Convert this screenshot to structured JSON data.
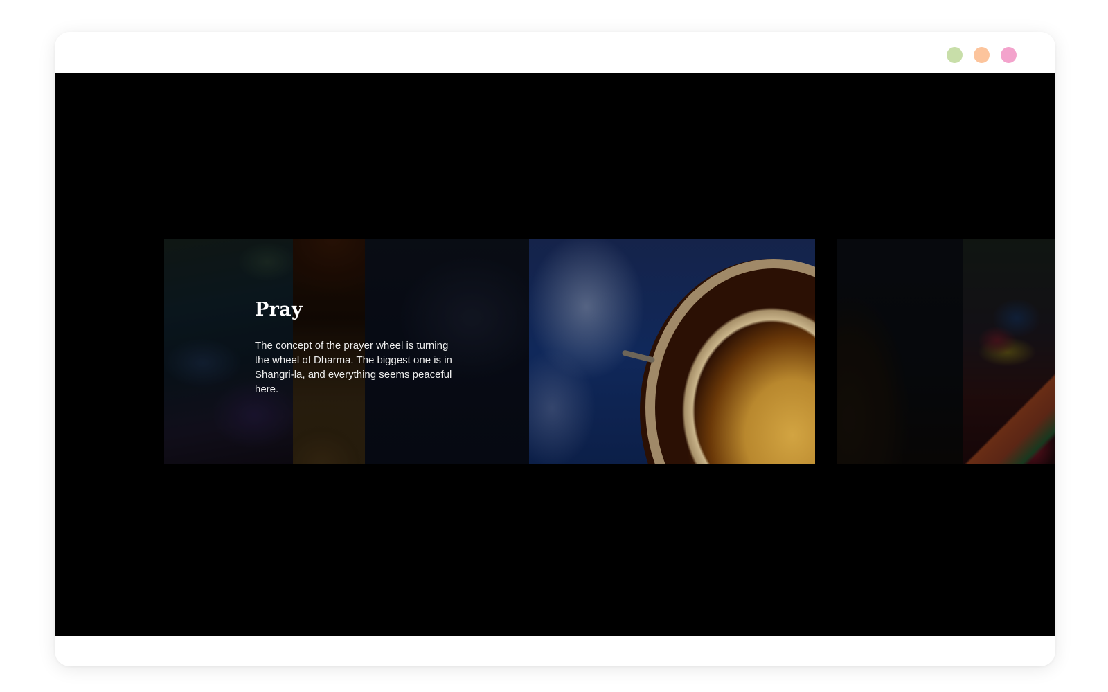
{
  "window": {
    "controls": [
      {
        "name": "green-dot",
        "color": "#c8dea9"
      },
      {
        "name": "orange-dot",
        "color": "#fcc49c"
      },
      {
        "name": "pink-dot",
        "color": "#f3a3cc"
      }
    ]
  },
  "slide": {
    "title": "Pray",
    "body": "The concept of the prayer wheel is turning the wheel of Dharma. The biggest one is in Shangri-la, and everything seems peaceful here."
  }
}
